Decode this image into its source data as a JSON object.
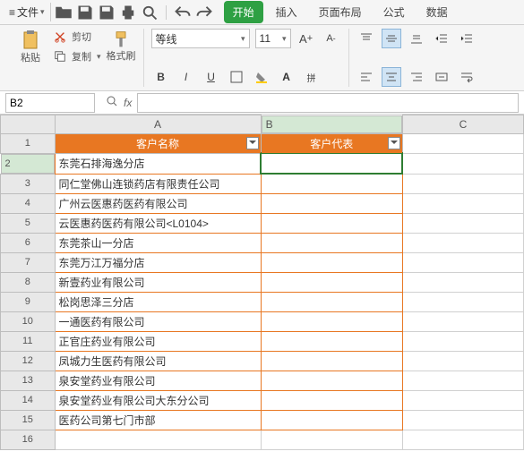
{
  "menubar": {
    "file_label": "文件",
    "tabs": {
      "start": "开始",
      "insert": "插入",
      "layout": "页面布局",
      "formula": "公式",
      "data": "数据"
    }
  },
  "toolbar": {
    "cut": "剪切",
    "copy": "复制",
    "paste": "粘贴",
    "format_painter": "格式刷",
    "font_name": "等线",
    "font_size": "11",
    "bold": "B",
    "italic": "I",
    "underline": "U"
  },
  "namebox_value": "B2",
  "fx_label": "fx",
  "formula_value": "",
  "columns": [
    "A",
    "B",
    "C"
  ],
  "header_row": {
    "A": "客户名称",
    "B": "客户代表"
  },
  "rows": [
    {
      "n": 1,
      "A": "",
      "B": ""
    },
    {
      "n": 2,
      "A": "东莞石排海逸分店",
      "B": ""
    },
    {
      "n": 3,
      "A": "同仁堂佛山连锁药店有限责任公司",
      "B": ""
    },
    {
      "n": 4,
      "A": "广州云医惠药医药有限公司",
      "B": ""
    },
    {
      "n": 5,
      "A": "云医惠药医药有限公司<L0104>",
      "B": ""
    },
    {
      "n": 6,
      "A": "东莞茶山一分店",
      "B": ""
    },
    {
      "n": 7,
      "A": "东莞万江万福分店",
      "B": ""
    },
    {
      "n": 8,
      "A": "新壹药业有限公司",
      "B": ""
    },
    {
      "n": 9,
      "A": "松岗思泽三分店",
      "B": ""
    },
    {
      "n": 10,
      "A": "一通医药有限公司",
      "B": ""
    },
    {
      "n": 11,
      "A": "正官庄药业有限公司",
      "B": ""
    },
    {
      "n": 12,
      "A": "凤城力生医药有限公司",
      "B": ""
    },
    {
      "n": 13,
      "A": "泉安堂药业有限公司",
      "B": ""
    },
    {
      "n": 14,
      "A": "泉安堂药业有限公司大东分公司",
      "B": ""
    },
    {
      "n": 15,
      "A": "医药公司第七门市部",
      "B": ""
    },
    {
      "n": 16,
      "A": "",
      "B": ""
    }
  ],
  "active_cell": "B2"
}
